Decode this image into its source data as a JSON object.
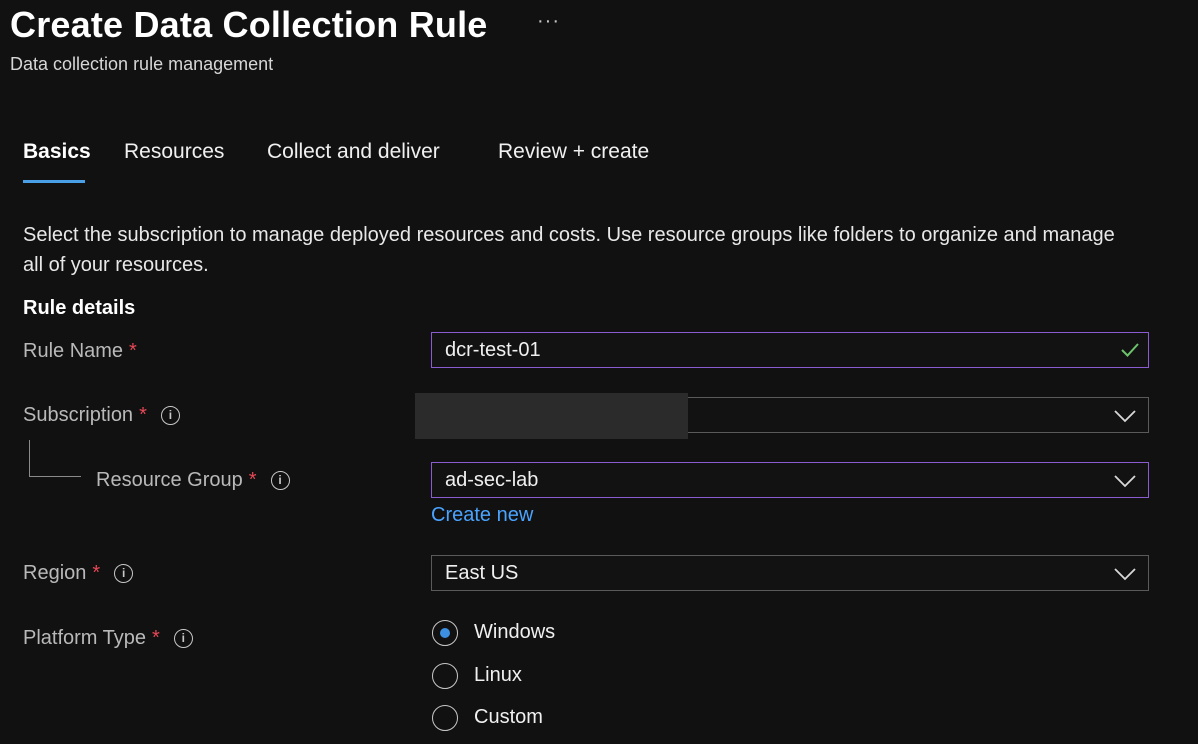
{
  "header": {
    "title": "Create Data Collection Rule",
    "more_label": "···",
    "subtitle": "Data collection rule management"
  },
  "tabs": [
    {
      "label": "Basics",
      "active": true
    },
    {
      "label": "Resources",
      "active": false
    },
    {
      "label": "Collect and deliver",
      "active": false
    },
    {
      "label": "Review + create",
      "active": false
    }
  ],
  "intro_text": "Select the subscription to manage deployed resources and costs. Use resource groups like folders to organize and manage all of your resources.",
  "section_title": "Rule details",
  "fields": {
    "rule_name": {
      "label": "Rule Name",
      "required": "*",
      "value": "dcr-test-01"
    },
    "subscription": {
      "label": "Subscription",
      "required": "*",
      "value": ""
    },
    "resource_group": {
      "label": "Resource Group",
      "required": "*",
      "value": "ad-sec-lab",
      "create_new": "Create new"
    },
    "region": {
      "label": "Region",
      "required": "*",
      "value": "East US"
    },
    "platform_type": {
      "label": "Platform Type",
      "required": "*",
      "options": [
        "Windows",
        "Linux",
        "Custom"
      ],
      "selected": "Windows"
    }
  },
  "info_glyph": "i",
  "colors": {
    "background": "#111111",
    "accent": "#4aa0e6",
    "link": "#4aa3ff",
    "required": "#e74856",
    "focus_border": "#8a5bd1",
    "valid_check": "#6cc36c"
  }
}
